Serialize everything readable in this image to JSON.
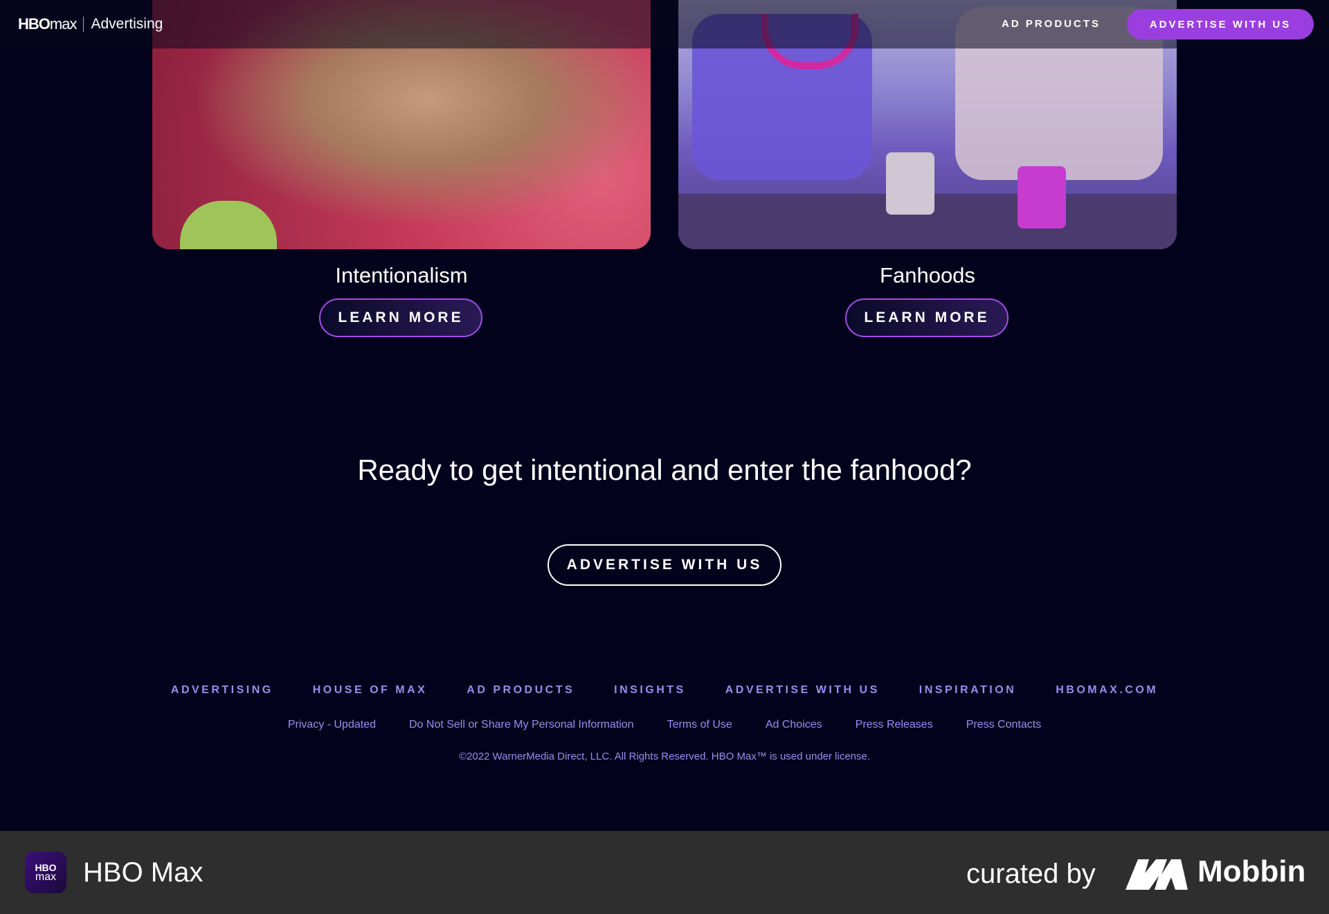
{
  "header": {
    "logo_brand": "HBO",
    "logo_brand_suffix": "max",
    "logo_section": "Advertising",
    "nav_link": "AD PRODUCTS",
    "nav_cta": "ADVERTISE WITH US"
  },
  "cards": [
    {
      "title": "Intentionalism",
      "button": "LEARN MORE"
    },
    {
      "title": "Fanhoods",
      "button": "LEARN MORE"
    }
  ],
  "cta": {
    "heading": "Ready to get intentional and enter the fanhood?",
    "button": "ADVERTISE WITH US"
  },
  "footer": {
    "nav": [
      "ADVERTISING",
      "HOUSE OF MAX",
      "AD PRODUCTS",
      "INSIGHTS",
      "ADVERTISE WITH US",
      "INSPIRATION",
      "HBOMAX.COM"
    ],
    "links": [
      "Privacy - Updated",
      "Do Not Sell or Share My Personal Information",
      "Terms of Use",
      "Ad Choices",
      "Press Releases",
      "Press Contacts"
    ],
    "copyright": "©2022 WarnerMedia Direct, LLC. All Rights Reserved. HBO Max™ is used under license."
  },
  "bottom_bar": {
    "app_icon_line1": "HBO",
    "app_icon_line2": "max",
    "app_name": "HBO Max",
    "curated_by": "curated by",
    "brand": "Mobbin"
  },
  "colors": {
    "background": "#02021c",
    "accent": "#9b3ee0",
    "footer_text": "#9a8ff0",
    "bottom_bar": "#2e2e2e"
  },
  "icons": [
    "hbomax-logo-icon",
    "mobbin-logo-icon"
  ]
}
